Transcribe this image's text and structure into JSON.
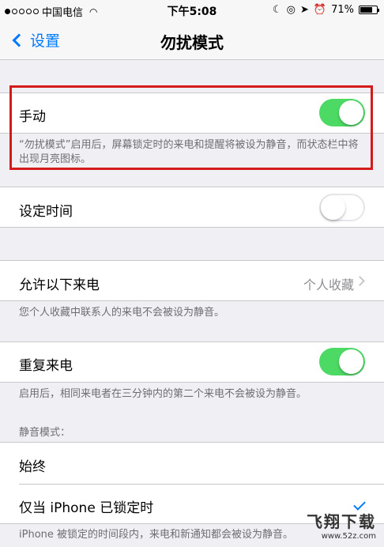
{
  "status_bar": {
    "carrier": "中国电信",
    "time": "下午5:08",
    "battery": "71%",
    "signal_level": 1,
    "battery_level": 0.71
  },
  "nav": {
    "back_label": "设置",
    "title": "勿扰模式"
  },
  "manual": {
    "label": "手动",
    "enabled": true,
    "footer": "“勿扰模式”启用后，屏幕锁定时的来电和提醒将被设为静音，而状态栏中将出现月亮图标。"
  },
  "scheduled": {
    "label": "设定时间",
    "enabled": false
  },
  "allow_calls": {
    "label": "允许以下来电",
    "value": "个人收藏",
    "footer": "您个人收藏中联系人的来电不会被设为静音。"
  },
  "repeated_calls": {
    "label": "重复来电",
    "enabled": true,
    "footer": "启用后，相同来电者在三分钟内的第二个来电不会被设为静音。"
  },
  "silence": {
    "header": "静音模式：",
    "option_always": "始终",
    "option_locked": "仅当 iPhone 已锁定时",
    "selected": "option_locked",
    "footer": "iPhone 被锁定的时间段内，来电和新通知都会被设为静音。"
  },
  "watermark": {
    "title": "飞翔下载",
    "url": "www.52z.com"
  },
  "colors": {
    "accent": "#007aff",
    "toggle_on": "#4cd964",
    "highlight": "#d51a1a"
  }
}
